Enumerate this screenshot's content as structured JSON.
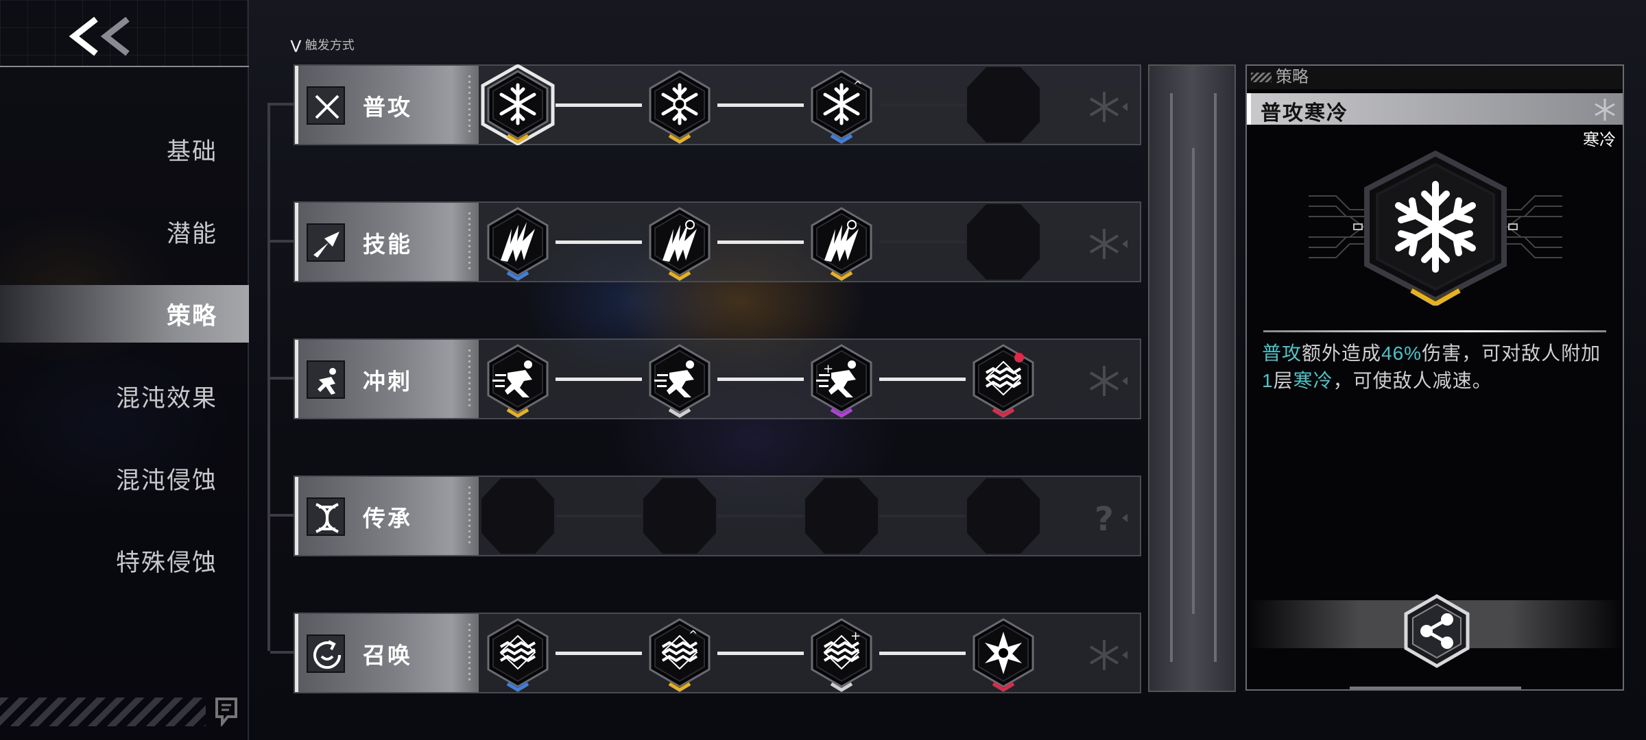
{
  "nav": {
    "back_icon": "double-chevron-left-icon",
    "items": [
      {
        "label": "基础",
        "active": false
      },
      {
        "label": "潜能",
        "active": false
      },
      {
        "label": "策略",
        "active": true
      },
      {
        "label": "混沌效果",
        "active": false
      },
      {
        "label": "混沌侵蚀",
        "active": false
      },
      {
        "label": "特殊侵蚀",
        "active": false
      }
    ]
  },
  "trigger": {
    "label": "触发方式"
  },
  "rows": [
    {
      "label": "普攻",
      "icon": "crossed-swords-icon",
      "nodes": [
        "snowflake",
        "snowflake-core",
        "snowflake-plus",
        "empty"
      ],
      "tiers": [
        "gold",
        "gold",
        "blue",
        ""
      ],
      "tail_icon": "snowflake-icon"
    },
    {
      "label": "技能",
      "icon": "arrow-burst-icon",
      "nodes": [
        "claw",
        "claw-rose",
        "claw-skull",
        "empty"
      ],
      "tiers": [
        "blue",
        "gold",
        "gold",
        ""
      ],
      "tail_icon": "claw-icon"
    },
    {
      "label": "冲刺",
      "icon": "running-icon",
      "nodes": [
        "runner",
        "runner",
        "runner-plus",
        "wave-alert"
      ],
      "tiers": [
        "gold",
        "white",
        "purple",
        "red"
      ],
      "tail_icon": "runner-icon"
    },
    {
      "label": "传承",
      "icon": "dna-icon",
      "nodes": [
        "empty",
        "empty",
        "empty",
        "empty"
      ],
      "tiers": [
        "",
        "",
        "",
        ""
      ],
      "tail_icon": "question-icon"
    },
    {
      "label": "召唤",
      "icon": "summon-swirl-icon",
      "nodes": [
        "wave",
        "wave-up",
        "wave-plus",
        "star-flower"
      ],
      "tiers": [
        "blue",
        "gold",
        "white",
        "red"
      ],
      "tail_icon": "wave-icon"
    }
  ],
  "detail": {
    "section": "策略",
    "title": "普攻寒冷",
    "tag": "寒冷",
    "icon": "snowflake-icon",
    "desc_parts": [
      {
        "text": "普攻",
        "hl": true
      },
      {
        "text": "额外造成",
        "hl": false
      },
      {
        "text": "46%",
        "hl": true
      },
      {
        "text": "伤害，可对敌人附加",
        "hl": false
      },
      {
        "text": "1",
        "hl": true
      },
      {
        "text": "层",
        "hl": false
      },
      {
        "text": "寒冷",
        "hl": true
      },
      {
        "text": "，可使敌人减速。",
        "hl": false
      }
    ],
    "share_icon": "share-icon"
  },
  "colors": {
    "gold": "#e8b21e",
    "blue": "#3f7fe0",
    "purple": "#b53ce0",
    "red": "#e0294a",
    "white": "#cfcfcf",
    "highlight": "#4ec4c8"
  }
}
